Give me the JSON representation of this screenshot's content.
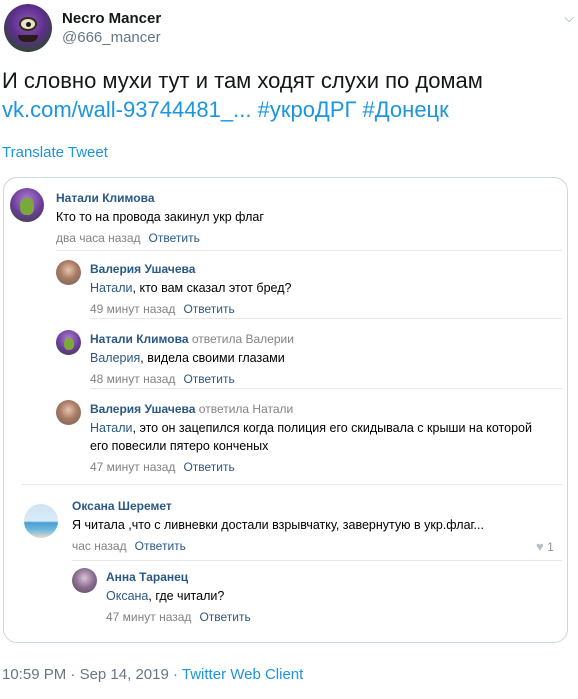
{
  "tweet": {
    "display_name": "Necro Mancer",
    "handle": "@666_mancer",
    "text": "И словно мухи тут и там ходят слухи по домам",
    "link": "vk.com/wall-93744481_...",
    "hashtag_1": "#укроДРГ",
    "hashtag_2": "#Донецк",
    "translate_label": "Translate Tweet",
    "caret_icon": "chevron-down-icon"
  },
  "comments": [
    {
      "author": "Натали Климова",
      "answered": "",
      "mention": "",
      "text": "Кто то на провода закинул укр флаг",
      "time": "два часа назад",
      "reply_label": "Ответить"
    },
    {
      "author": "Валерия Ушачева",
      "answered": "",
      "mention": "Натали",
      "text": ", кто вам сказал этот бред?",
      "time": "49 минут назад",
      "reply_label": "Ответить"
    },
    {
      "author": "Натали Климова",
      "answered": "ответила Валерии",
      "mention": "Валерия",
      "text": ", видела своими глазами",
      "time": "48 минут назад",
      "reply_label": "Ответить"
    },
    {
      "author": "Валерия Ушачева",
      "answered": "ответила Натали",
      "mention": "Натали",
      "text": ", это он зацепился когда полиция его скидывала с крыши на которой его повесили пятеро конченых",
      "time": "47 минут назад",
      "reply_label": "Ответить"
    },
    {
      "author": "Оксана Шеремет",
      "answered": "",
      "mention": "",
      "text": "Я читала ,что с ливневки достали взрывчатку, завернутую в укр.флаг...",
      "time": "час назад",
      "reply_label": "Ответить",
      "likes": "1"
    },
    {
      "author": "Анна Таранец",
      "answered": "",
      "mention": "Оксана",
      "text": ", где читали?",
      "time": "47 минут назад",
      "reply_label": "Ответить"
    }
  ],
  "footer": {
    "time": "10:59 PM",
    "sep": "·",
    "date": "Sep 14, 2019",
    "client": "Twitter Web Client"
  },
  "colors": {
    "twitter_blue": "#1b95e0",
    "vk_name": "#2a5885",
    "vk_meta": "#828282"
  }
}
